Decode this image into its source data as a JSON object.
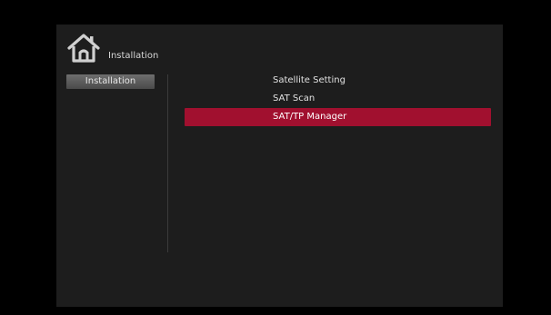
{
  "header": {
    "title": "Installation",
    "icon": "home-icon"
  },
  "sidebar": {
    "items": [
      {
        "label": "Installation",
        "active": true
      }
    ]
  },
  "menu": {
    "items": [
      {
        "label": "Satellite Setting",
        "selected": false
      },
      {
        "label": "SAT Scan",
        "selected": false
      },
      {
        "label": "SAT/TP Manager",
        "selected": true
      }
    ]
  },
  "colors": {
    "background": "#000000",
    "panel": "#1d1d1d",
    "highlight": "#a1102f",
    "tab": "#5a5a5a",
    "text": "#e2e2e2"
  }
}
